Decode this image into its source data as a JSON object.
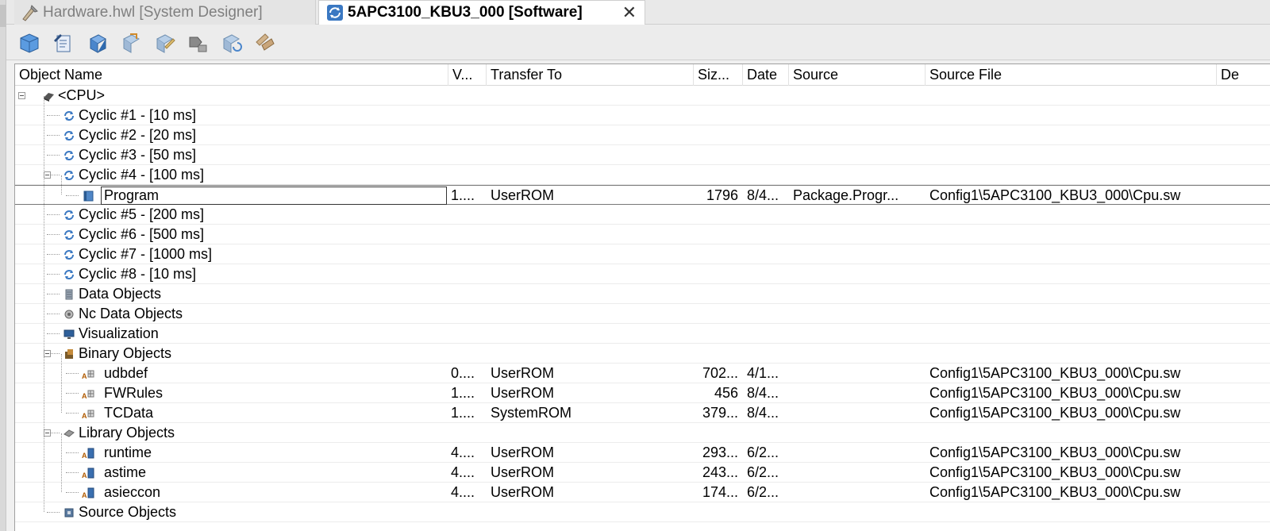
{
  "tabs": [
    {
      "label": "Hardware.hwl [System Designer]",
      "active": false
    },
    {
      "label": "5APC3100_KBU3_000 [Software]",
      "active": true
    }
  ],
  "tab_close": "✕",
  "toolbar": {
    "buttons": [
      "add-object-icon",
      "properties-icon",
      "open-icon",
      "transfer-icon",
      "edit-icon",
      "paste-icon",
      "refresh-icon",
      "delete-icon"
    ]
  },
  "columns": [
    "Object Name",
    "V...",
    "Transfer To",
    "Siz...",
    "Date",
    "Source",
    "Source File",
    "De"
  ],
  "rows": [
    {
      "name": "<CPU>",
      "level": 0,
      "icon": "cpu-icon",
      "expander": true
    },
    {
      "name": "Cyclic #1 - [10 ms]",
      "level": 1,
      "icon": "cyclic-icon"
    },
    {
      "name": "Cyclic #2 - [20 ms]",
      "level": 1,
      "icon": "cyclic-icon"
    },
    {
      "name": "Cyclic #3 - [50 ms]",
      "level": 1,
      "icon": "cyclic-icon"
    },
    {
      "name": "Cyclic #4 - [100 ms]",
      "level": 1,
      "icon": "cyclic-icon",
      "expander": true
    },
    {
      "name": "Program",
      "level": 2,
      "icon": "program-icon",
      "selected": true,
      "version": "1....",
      "transfer": "UserROM",
      "size": "1796",
      "date": "8/4...",
      "source": "Package.Progr...",
      "source_file": "Config1\\5APC3100_KBU3_000\\Cpu.sw"
    },
    {
      "name": "Cyclic #5 - [200 ms]",
      "level": 1,
      "icon": "cyclic-icon"
    },
    {
      "name": "Cyclic #6 - [500 ms]",
      "level": 1,
      "icon": "cyclic-icon"
    },
    {
      "name": "Cyclic #7 - [1000 ms]",
      "level": 1,
      "icon": "cyclic-icon"
    },
    {
      "name": "Cyclic #8 - [10 ms]",
      "level": 1,
      "icon": "cyclic-icon"
    },
    {
      "name": "Data Objects",
      "level": 1,
      "icon": "data-objects-icon"
    },
    {
      "name": "Nc Data Objects",
      "level": 1,
      "icon": "nc-data-icon"
    },
    {
      "name": "Visualization",
      "level": 1,
      "icon": "visualization-icon"
    },
    {
      "name": "Binary Objects",
      "level": 1,
      "icon": "binary-objects-icon",
      "expander": true
    },
    {
      "name": "udbdef",
      "level": 2,
      "icon": "binary-file-icon",
      "version": "0....",
      "transfer": "UserROM",
      "size": "702...",
      "date": "4/1...",
      "source": "",
      "source_file": "Config1\\5APC3100_KBU3_000\\Cpu.sw"
    },
    {
      "name": "FWRules",
      "level": 2,
      "icon": "binary-file-icon",
      "version": "1....",
      "transfer": "UserROM",
      "size": "456",
      "date": "8/4...",
      "source": "",
      "source_file": "Config1\\5APC3100_KBU3_000\\Cpu.sw"
    },
    {
      "name": "TCData",
      "level": 2,
      "icon": "binary-file-icon",
      "version": "1....",
      "transfer": "SystemROM",
      "size": "379...",
      "date": "8/4...",
      "source": "",
      "source_file": "Config1\\5APC3100_KBU3_000\\Cpu.sw"
    },
    {
      "name": "Library Objects",
      "level": 1,
      "icon": "library-objects-icon",
      "expander": true
    },
    {
      "name": "runtime",
      "level": 2,
      "icon": "library-file-icon",
      "version": "4....",
      "transfer": "UserROM",
      "size": "293...",
      "date": "6/2...",
      "source": "",
      "source_file": "Config1\\5APC3100_KBU3_000\\Cpu.sw"
    },
    {
      "name": "astime",
      "level": 2,
      "icon": "library-file-icon",
      "version": "4....",
      "transfer": "UserROM",
      "size": "243...",
      "date": "6/2...",
      "source": "",
      "source_file": "Config1\\5APC3100_KBU3_000\\Cpu.sw"
    },
    {
      "name": "asieccon",
      "level": 2,
      "icon": "library-file-icon",
      "version": "4....",
      "transfer": "UserROM",
      "size": "174...",
      "date": "6/2...",
      "source": "",
      "source_file": "Config1\\5APC3100_KBU3_000\\Cpu.sw"
    },
    {
      "name": "Source Objects",
      "level": 1,
      "icon": "source-objects-icon"
    }
  ]
}
